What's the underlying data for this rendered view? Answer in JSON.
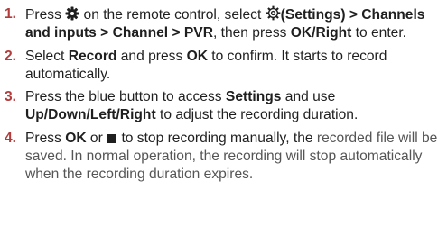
{
  "accent_number_color": "#b23b3b",
  "icons": {
    "gear": "gear-icon",
    "settings": "settings-icon",
    "stop": "stop-square-icon"
  },
  "steps": [
    {
      "number": "1.",
      "parts": {
        "a": "Press ",
        "b": " on the remote control, select ",
        "c": "(Settings) > Channels and inputs > Channel > PVR",
        "d": ", then press ",
        "e": "OK/Right",
        "f": " to enter."
      }
    },
    {
      "number": "2.",
      "parts": {
        "a": "Select ",
        "b": "Record",
        "c": " and press ",
        "d": "OK",
        "e": " to confirm. It starts to record automatically."
      }
    },
    {
      "number": "3.",
      "parts": {
        "a": "Press the blue button to access ",
        "b": "Settings",
        "c": " and use ",
        "d": "Up/Down/Left/Right",
        "e": " to adjust the recording duration."
      }
    },
    {
      "number": "4.",
      "parts": {
        "a": "Press ",
        "b": "OK",
        "c": " or ",
        "d": " to stop recording manually, the ",
        "e": "recorded file will be saved. In normal operation, the recording will stop automatically when the recording duration expires."
      }
    }
  ]
}
